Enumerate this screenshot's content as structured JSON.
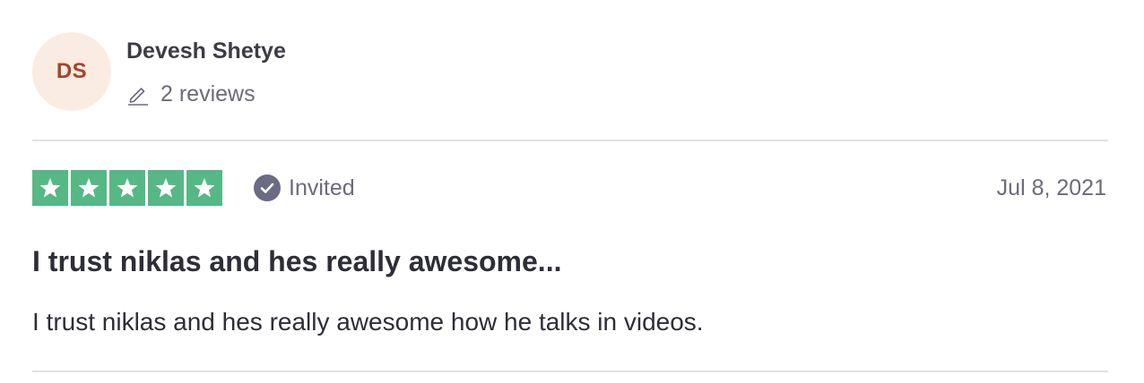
{
  "consumer": {
    "initials": "DS",
    "name": "Devesh Shetye",
    "review_count": "2 reviews",
    "avatar_bg": "#fbece3",
    "avatar_text_color": "#a4442a",
    "review_icon": "pencil-icon"
  },
  "review": {
    "rating": 5,
    "max_rating": 5,
    "star_color": "#56b885",
    "invited_label": "Invited",
    "invited_icon": "check-circle-icon",
    "date": "Jul 8, 2021",
    "title": "I trust niklas and hes really awesome...",
    "body": "I trust niklas and hes really awesome how he talks in videos."
  }
}
